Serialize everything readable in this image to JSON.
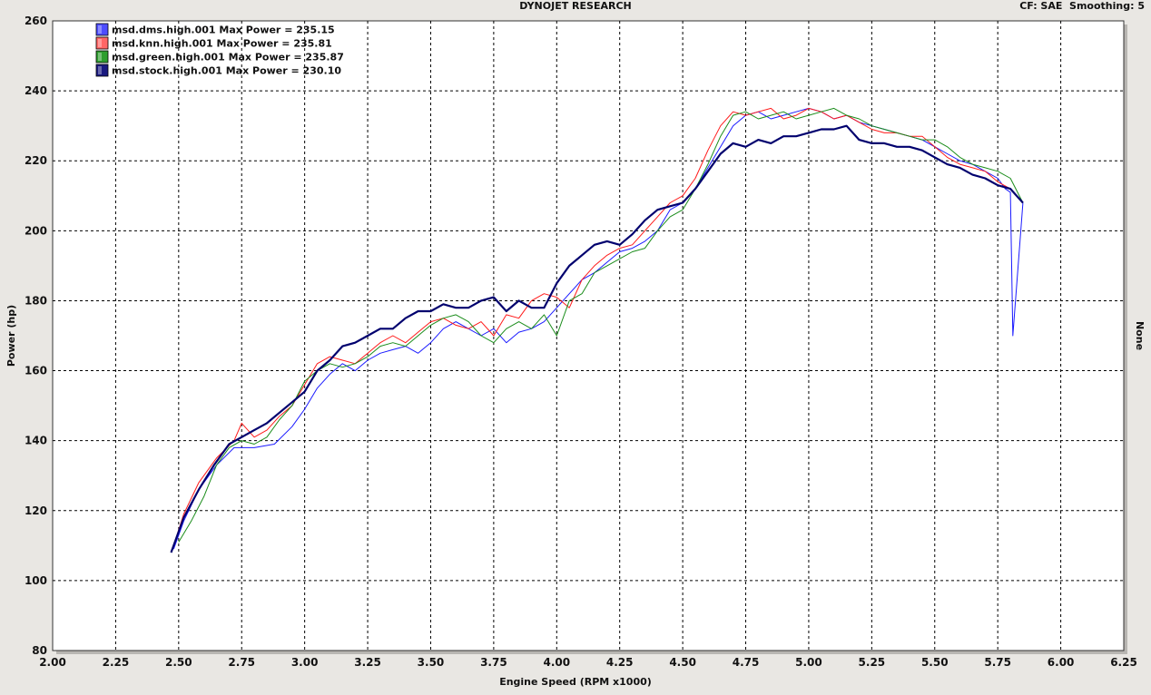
{
  "header": {
    "title": "DYNOJET RESEARCH",
    "right_info": "CF: SAE  Smoothing: 5"
  },
  "right_axis_label": "None",
  "colors": {
    "background": "#e9e7e3",
    "plot_bg": "#ffffff",
    "grid": "#000000"
  },
  "chart_data": {
    "type": "line",
    "title": "DYNOJET RESEARCH",
    "xlabel": "Engine Speed (RPM x1000)",
    "ylabel": "Power (hp)",
    "xlim": [
      2.0,
      6.25
    ],
    "ylim": [
      80,
      260
    ],
    "x_ticks": [
      "2.00",
      "2.25",
      "2.50",
      "2.75",
      "3.00",
      "3.25",
      "3.50",
      "3.75",
      "4.00",
      "4.25",
      "4.50",
      "4.75",
      "5.00",
      "5.25",
      "5.50",
      "5.75",
      "6.00",
      "6.25"
    ],
    "y_ticks": [
      "80",
      "100",
      "120",
      "140",
      "160",
      "180",
      "200",
      "220",
      "240",
      "260"
    ],
    "grid": true,
    "legend_position": "top-left",
    "series": [
      {
        "name": "msd.dms.high.001 Max Power = 235.15",
        "color": "#1a1aff",
        "legend_color": "#4d4dff",
        "x": [
          2.48,
          2.52,
          2.58,
          2.65,
          2.72,
          2.8,
          2.88,
          2.95,
          3.0,
          3.05,
          3.1,
          3.15,
          3.2,
          3.25,
          3.3,
          3.35,
          3.4,
          3.45,
          3.5,
          3.55,
          3.6,
          3.65,
          3.7,
          3.75,
          3.8,
          3.85,
          3.9,
          3.95,
          4.0,
          4.05,
          4.1,
          4.15,
          4.2,
          4.25,
          4.3,
          4.35,
          4.4,
          4.45,
          4.5,
          4.55,
          4.6,
          4.65,
          4.7,
          4.75,
          4.8,
          4.85,
          4.9,
          4.95,
          5.0,
          5.05,
          5.1,
          5.15,
          5.2,
          5.25,
          5.3,
          5.35,
          5.4,
          5.45,
          5.5,
          5.55,
          5.6,
          5.65,
          5.7,
          5.75,
          5.78,
          5.8,
          5.81,
          5.85
        ],
        "values": [
          109,
          117,
          126,
          133,
          138,
          138,
          139,
          144,
          149,
          155,
          159,
          162,
          160,
          163,
          165,
          166,
          167,
          165,
          168,
          172,
          174,
          172,
          170,
          172,
          168,
          171,
          172,
          174,
          178,
          182,
          186,
          188,
          191,
          194,
          195,
          197,
          200,
          206,
          208,
          212,
          218,
          224,
          230,
          233,
          234,
          232,
          233,
          234,
          235,
          234,
          232,
          233,
          231,
          230,
          229,
          228,
          227,
          226,
          224,
          222,
          220,
          219,
          217,
          215,
          212,
          211,
          170,
          208
        ]
      },
      {
        "name": "msd.knn.high.001 Max Power = 235.81",
        "color": "#ff1a1a",
        "legend_color": "#ff6666",
        "x": [
          2.48,
          2.52,
          2.58,
          2.65,
          2.72,
          2.75,
          2.8,
          2.85,
          2.9,
          2.95,
          3.0,
          3.05,
          3.1,
          3.15,
          3.2,
          3.25,
          3.3,
          3.35,
          3.4,
          3.45,
          3.5,
          3.55,
          3.6,
          3.65,
          3.7,
          3.75,
          3.8,
          3.85,
          3.9,
          3.95,
          4.0,
          4.05,
          4.1,
          4.15,
          4.2,
          4.25,
          4.3,
          4.35,
          4.4,
          4.45,
          4.5,
          4.55,
          4.6,
          4.65,
          4.7,
          4.75,
          4.8,
          4.85,
          4.9,
          4.95,
          5.0,
          5.05,
          5.1,
          5.15,
          5.2,
          5.25,
          5.3,
          5.35,
          5.4,
          5.45,
          5.5,
          5.55,
          5.6,
          5.65,
          5.7,
          5.75,
          5.8,
          5.85
        ],
        "values": [
          110,
          119,
          128,
          135,
          140,
          145,
          141,
          143,
          147,
          150,
          156,
          162,
          164,
          163,
          162,
          165,
          168,
          170,
          168,
          171,
          174,
          175,
          173,
          172,
          174,
          170,
          176,
          175,
          180,
          182,
          181,
          178,
          186,
          190,
          193,
          195,
          196,
          200,
          204,
          208,
          210,
          215,
          223,
          230,
          234,
          233,
          234,
          235,
          232,
          233,
          235,
          234,
          232,
          233,
          231,
          229,
          228,
          228,
          227,
          227,
          224,
          221,
          219,
          218,
          217,
          214,
          212,
          208
        ]
      },
      {
        "name": "msd.green.high.001 Max Power = 235.87",
        "color": "#1a8c1a",
        "legend_color": "#2e9e2e",
        "x": [
          2.5,
          2.55,
          2.6,
          2.65,
          2.7,
          2.75,
          2.8,
          2.85,
          2.9,
          2.95,
          3.0,
          3.05,
          3.1,
          3.15,
          3.2,
          3.25,
          3.3,
          3.35,
          3.4,
          3.45,
          3.5,
          3.55,
          3.6,
          3.65,
          3.7,
          3.75,
          3.8,
          3.85,
          3.9,
          3.95,
          4.0,
          4.05,
          4.1,
          4.15,
          4.2,
          4.25,
          4.3,
          4.35,
          4.4,
          4.45,
          4.5,
          4.55,
          4.6,
          4.65,
          4.7,
          4.75,
          4.8,
          4.85,
          4.9,
          4.95,
          5.0,
          5.05,
          5.1,
          5.15,
          5.2,
          5.25,
          5.3,
          5.35,
          5.4,
          5.45,
          5.5,
          5.55,
          5.6,
          5.65,
          5.7,
          5.75,
          5.8,
          5.85
        ],
        "values": [
          111,
          117,
          124,
          133,
          138,
          140,
          139,
          141,
          146,
          150,
          157,
          160,
          162,
          161,
          162,
          164,
          167,
          168,
          167,
          170,
          173,
          175,
          176,
          174,
          170,
          168,
          172,
          174,
          172,
          176,
          170,
          180,
          182,
          188,
          190,
          192,
          194,
          195,
          200,
          204,
          206,
          212,
          219,
          227,
          233,
          234,
          232,
          233,
          234,
          232,
          233,
          234,
          235,
          233,
          232,
          230,
          229,
          228,
          227,
          226,
          226,
          224,
          221,
          219,
          218,
          217,
          215,
          208
        ]
      },
      {
        "name": "msd.stock.high.001 Max Power = 230.10",
        "color": "#00006e",
        "legend_color": "#1a1a80",
        "x": [
          2.47,
          2.52,
          2.58,
          2.64,
          2.7,
          2.75,
          2.8,
          2.85,
          2.9,
          2.95,
          3.0,
          3.05,
          3.1,
          3.15,
          3.2,
          3.25,
          3.3,
          3.35,
          3.4,
          3.45,
          3.5,
          3.55,
          3.6,
          3.65,
          3.7,
          3.75,
          3.8,
          3.85,
          3.9,
          3.95,
          4.0,
          4.05,
          4.1,
          4.15,
          4.2,
          4.25,
          4.3,
          4.35,
          4.4,
          4.45,
          4.5,
          4.55,
          4.6,
          4.65,
          4.7,
          4.75,
          4.8,
          4.85,
          4.9,
          4.95,
          5.0,
          5.05,
          5.1,
          5.15,
          5.2,
          5.25,
          5.3,
          5.35,
          5.4,
          5.45,
          5.5,
          5.55,
          5.6,
          5.65,
          5.7,
          5.75,
          5.8,
          5.85
        ],
        "values": [
          108,
          118,
          126,
          133,
          139,
          141,
          143,
          145,
          148,
          151,
          154,
          160,
          163,
          167,
          168,
          170,
          172,
          172,
          175,
          177,
          177,
          179,
          178,
          178,
          180,
          181,
          177,
          180,
          178,
          178,
          185,
          190,
          193,
          196,
          197,
          196,
          199,
          203,
          206,
          207,
          208,
          212,
          217,
          222,
          225,
          224,
          226,
          225,
          227,
          227,
          228,
          229,
          229,
          230,
          226,
          225,
          225,
          224,
          224,
          223,
          221,
          219,
          218,
          216,
          215,
          213,
          212,
          208
        ]
      }
    ]
  }
}
